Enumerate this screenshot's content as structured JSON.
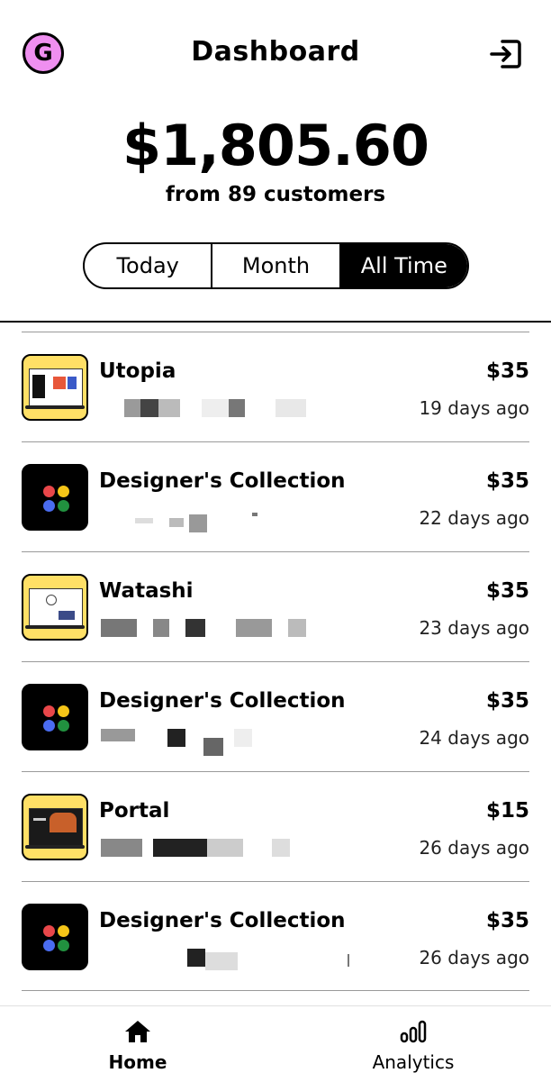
{
  "header": {
    "avatar_letter": "G",
    "title": "Dashboard",
    "logout_icon": "logout-icon"
  },
  "summary": {
    "total": "$1,805.60",
    "subtitle": "from 89 customers"
  },
  "range_tabs": [
    {
      "label": "Today",
      "active": false
    },
    {
      "label": "Month",
      "active": false
    },
    {
      "label": "All Time",
      "active": true
    }
  ],
  "sales": [
    {
      "name": "Utopia",
      "price": "$35",
      "when": "19 days ago",
      "thumb": "yellow-laptop"
    },
    {
      "name": "Designer's Collection",
      "price": "$35",
      "when": "22 days ago",
      "thumb": "black-dots"
    },
    {
      "name": "Watashi",
      "price": "$35",
      "when": "23 days ago",
      "thumb": "yellow-laptop"
    },
    {
      "name": "Designer's Collection",
      "price": "$35",
      "when": "24 days ago",
      "thumb": "black-dots"
    },
    {
      "name": "Portal",
      "price": "$15",
      "when": "26 days ago",
      "thumb": "yellow-laptop"
    },
    {
      "name": "Designer's Collection",
      "price": "$35",
      "when": "26 days ago",
      "thumb": "black-dots"
    }
  ],
  "tabbar": [
    {
      "label": "Home",
      "icon": "home-icon",
      "active": true
    },
    {
      "label": "Analytics",
      "icon": "analytics-icon",
      "active": false
    }
  ],
  "colors": {
    "avatar_bg": "#ef8ff0",
    "thumb_yellow": "#ffe066",
    "dot_red": "#e9474a",
    "dot_yellow": "#f5c518",
    "dot_blue": "#4a6cf0",
    "dot_green": "#21913f"
  }
}
